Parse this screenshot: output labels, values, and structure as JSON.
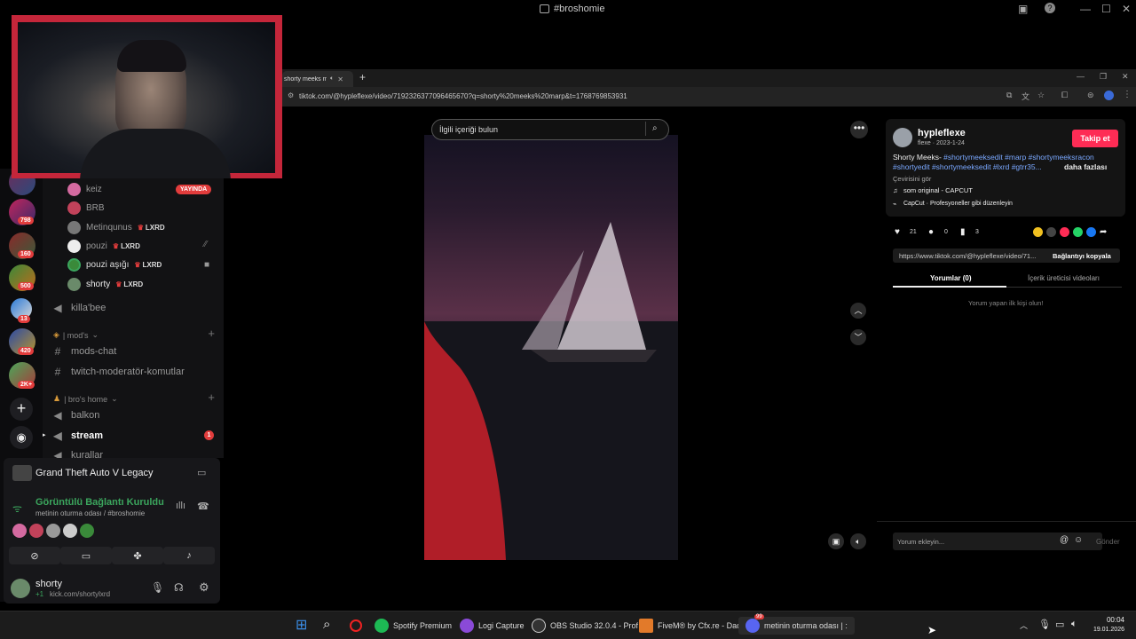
{
  "discord": {
    "window_title": "#broshomie",
    "server_badges": [
      "798",
      "160",
      "500",
      "13",
      "420",
      "2K+"
    ],
    "voice_users": [
      {
        "name": "keiz",
        "badge": "YAYINDA"
      },
      {
        "name": "BRB"
      },
      {
        "name": "Metinqunus",
        "tag": "LXRD"
      },
      {
        "name": "pouzi",
        "tag": "LXRD"
      },
      {
        "name": "pouzi aşığı",
        "tag": "LXRD"
      },
      {
        "name": "shorty",
        "tag": "LXRD"
      }
    ],
    "channels": {
      "killabee": "killa'bee",
      "mods_category": "| mod's",
      "mods_chat": "mods-chat",
      "twitch_mod": "twitch-moderatör-komutlar",
      "bros_category": "| bro's home",
      "balkon": "balkon",
      "stream": "stream",
      "stream_badge": "1",
      "kurallar": "kurallar"
    },
    "activity": "Grand Theft Auto V Legacy",
    "voice_status": "Görüntülü Bağlantı Kuruldu",
    "voice_channel": "metinin oturma odası / #broshomie",
    "user": {
      "name": "shorty",
      "status": "kick.com/shortylxrd",
      "status_prefix": "+1"
    },
    "colors": {
      "connected": "#3ba55d",
      "live": "#e23c3c"
    }
  },
  "browser": {
    "tab_label": "shorty meeks ma",
    "url": "tiktok.com/@hypleflexe/video/7192326377096465670?q=shorty%20meeks%20marp&t=1768769853931"
  },
  "tiktok": {
    "search_placeholder": "İlgili içeriği bulun",
    "username": "hypleflexe",
    "subline": "flexe · 2023-1-24",
    "follow_label": "Takip et",
    "desc_prefix": "Shorty Meeks-",
    "hashtags_1": "#shortymeeksedit #marp #shortymeeksracon",
    "hashtags_2": "#shortyedit #shortymeeksedit #lxrd #gtrr35...",
    "more_label": "daha fazlası",
    "translate": "Çevirisini gör",
    "sound": "som original - CAPCUT",
    "capcut": "CapCut · Profesyoneller gibi düzenleyin",
    "likes": "21",
    "comments": "0",
    "saves": "3",
    "link": "https://www.tiktok.com/@hypleflexe/video/71...",
    "copy_link": "Bağlantıyı kopyala",
    "tab_comments": "Yorumlar (0)",
    "tab_creator": "İçerik üreticisi videoları",
    "no_comments": "Yorum yapan ilk kişi olun!",
    "comment_placeholder": "Yorum ekleyin...",
    "send_label": "Gönder",
    "colors": {
      "follow": "#fe2c55",
      "hashtag": "#7aa8ff"
    }
  },
  "taskbar": {
    "apps": [
      "Spotify Premium",
      "Logi Capture",
      "OBS Studio 32.0.4 - Prof",
      "FiveM® by Cfx.re - Dad",
      "metinin oturma odası | :"
    ],
    "time": "00:04",
    "date": "19.01.2026",
    "discord_badge": "99"
  }
}
